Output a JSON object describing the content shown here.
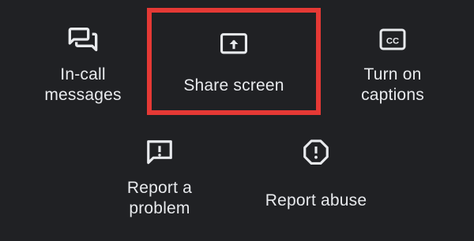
{
  "colors": {
    "background": "#202124",
    "text": "#e8eaed",
    "highlight_border": "#e53935"
  },
  "menu": {
    "items": [
      {
        "id": "in-call-messages",
        "label": "In-call\nmessages",
        "icon": "chat-bubbles-icon"
      },
      {
        "id": "share-screen",
        "label": "Share screen",
        "icon": "present-screen-icon",
        "highlighted": true
      },
      {
        "id": "turn-on-captions",
        "label": "Turn on\ncaptions",
        "icon": "closed-captions-icon"
      },
      {
        "id": "report-a-problem",
        "label": "Report a\nproblem",
        "icon": "feedback-icon"
      },
      {
        "id": "report-abuse",
        "label": "Report abuse",
        "icon": "report-octagon-icon"
      }
    ]
  }
}
